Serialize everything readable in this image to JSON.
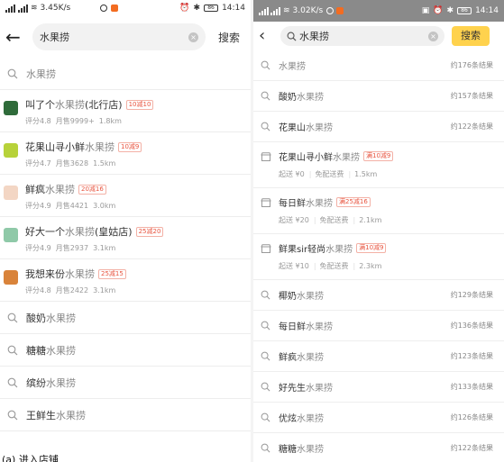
{
  "left": {
    "status": {
      "signal": "⁴ᴳ",
      "speed": "3.45K/s",
      "battery": "86",
      "time": "14:14"
    },
    "search": {
      "query": "水果捞",
      "button": "搜索"
    },
    "rows": [
      {
        "kind": "suggest",
        "pre": "",
        "hl": "水果捞",
        "post": ""
      },
      {
        "kind": "shop",
        "pre": "叫了个",
        "hl": "水果捞",
        "post": "(北行店)",
        "promo": "10减10",
        "rating": "评分4.8",
        "sales": "月售9999+",
        "dist": "1.8km",
        "thumb": "#2f6b3a"
      },
      {
        "kind": "shop",
        "pre": "花果山寻小鲜",
        "hl": "水果捞",
        "post": "",
        "promo": "10减9",
        "rating": "评分4.7",
        "sales": "月售3628",
        "dist": "1.5km",
        "thumb": "#b7d23a"
      },
      {
        "kind": "shop",
        "pre": "鲜疯",
        "hl": "水果捞",
        "post": "",
        "promo": "20减16",
        "rating": "评分4.9",
        "sales": "月售4421",
        "dist": "3.0km",
        "thumb": "#f3d6c4"
      },
      {
        "kind": "shop",
        "pre": "好大一个",
        "hl": "水果捞",
        "post": "(皇姑店)",
        "promo": "25减20",
        "rating": "评分4.9",
        "sales": "月售2937",
        "dist": "3.1km",
        "thumb": "#8fc9a8"
      },
      {
        "kind": "shop",
        "pre": "我想来份",
        "hl": "水果捞",
        "post": "",
        "promo": "25减15",
        "rating": "评分4.8",
        "sales": "月售2422",
        "dist": "3.1km",
        "thumb": "#d9833a"
      },
      {
        "kind": "suggest",
        "pre": "酸奶",
        "hl": "水果捞",
        "post": ""
      },
      {
        "kind": "suggest",
        "pre": "糖糖",
        "hl": "水果捞",
        "post": ""
      },
      {
        "kind": "suggest",
        "pre": "缤纷",
        "hl": "水果捞",
        "post": ""
      },
      {
        "kind": "suggest",
        "pre": "王鲜生",
        "hl": "水果捞",
        "post": ""
      }
    ],
    "caption": "(a) 进入店铺"
  },
  "right": {
    "status": {
      "speed": "3.02K/s",
      "battery": "86",
      "time": "14:14"
    },
    "search": {
      "query": "水果捞",
      "button": "搜索"
    },
    "rows": [
      {
        "kind": "suggest",
        "pre": "",
        "hl": "水果捞",
        "count": "约176条结果"
      },
      {
        "kind": "suggest",
        "pre": "酸奶",
        "hl": "水果捞",
        "count": "约157条结果"
      },
      {
        "kind": "suggest",
        "pre": "花果山",
        "hl": "水果捞",
        "count": "约122条结果"
      },
      {
        "kind": "shop",
        "pre": "花果山寻小鲜",
        "hl": "水果捞",
        "promo": "满10减9",
        "start": "起送 ¥0",
        "fee": "免配送费",
        "dist": "1.5km"
      },
      {
        "kind": "shop",
        "pre": "每日鲜",
        "hl": "水果捞",
        "promo": "满25减16",
        "start": "起送 ¥20",
        "fee": "免配送费",
        "dist": "2.1km"
      },
      {
        "kind": "shop",
        "pre": "鲜果sir轻尚",
        "hl": "水果捞",
        "promo": "满10减9",
        "start": "起送 ¥10",
        "fee": "免配送费",
        "dist": "2.3km"
      },
      {
        "kind": "suggest",
        "pre": "椰奶",
        "hl": "水果捞",
        "count": "约129条结果"
      },
      {
        "kind": "suggest",
        "pre": "每日鲜",
        "hl": "水果捞",
        "count": "约136条结果"
      },
      {
        "kind": "suggest",
        "pre": "鲜疯",
        "hl": "水果捞",
        "count": "约123条结果"
      },
      {
        "kind": "suggest",
        "pre": "好先生",
        "hl": "水果捞",
        "count": "约133条结果"
      },
      {
        "kind": "suggest",
        "pre": "优炫",
        "hl": "水果捞",
        "count": "约126条结果"
      },
      {
        "kind": "suggest",
        "pre": "糖糖",
        "hl": "水果捞",
        "count": "约122条结果"
      }
    ]
  }
}
